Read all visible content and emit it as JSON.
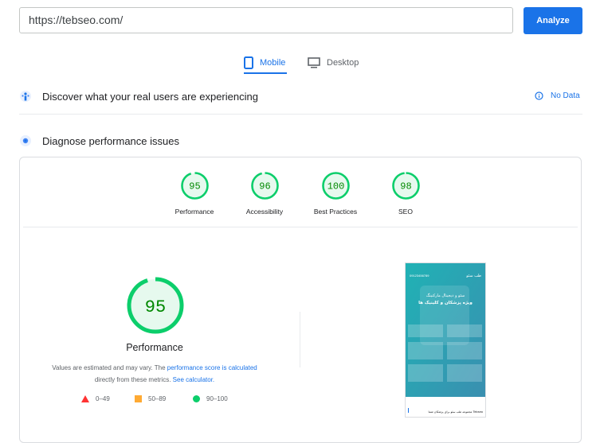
{
  "url_input": {
    "value": "https://tebseo.com/"
  },
  "analyze_button": {
    "label": "Analyze"
  },
  "tabs": [
    {
      "label": "Mobile",
      "active": true,
      "icon": "smartphone-icon"
    },
    {
      "label": "Desktop",
      "active": false,
      "icon": "monitor-icon"
    }
  ],
  "field_data": {
    "title": "Discover what your real users are experiencing",
    "no_data_label": "No Data",
    "icon": "users-icon"
  },
  "diagnose": {
    "title": "Diagnose performance issues",
    "icon": "lighthouse-icon"
  },
  "scores": [
    {
      "label": "Performance",
      "value": "95",
      "fraction": 0.95
    },
    {
      "label": "Accessibility",
      "value": "96",
      "fraction": 0.96
    },
    {
      "label": "Best Practices",
      "value": "100",
      "fraction": 1.0
    },
    {
      "label": "SEO",
      "value": "98",
      "fraction": 0.98
    }
  ],
  "main_score": {
    "value": "95",
    "fraction": 0.95,
    "label": "Performance",
    "disclaimer_1": "Values are estimated and may vary. The",
    "disclaimer_link_1": "performance score is calculated",
    "disclaimer_2": "directly from these metrics.",
    "disclaimer_link_2": "See calculator."
  },
  "legend": [
    {
      "range": "0–49",
      "color": "#ff3333",
      "shape": "triangle"
    },
    {
      "range": "50–89",
      "color": "#ffaa33",
      "shape": "square"
    },
    {
      "range": "90–100",
      "color": "#0cce6b",
      "shape": "circle"
    }
  ],
  "colors": {
    "accent": "#1a73e8",
    "pass_green": "#0cce6b",
    "pass_text": "#008800",
    "pass_fill": "#e6f9ee"
  },
  "phone_preview": {
    "header_phone": "09123456789",
    "header_logo": "طب سئو",
    "headline_1": "سئو و دیجیتال مارکتینگ",
    "headline_2": "ویژه پزشکان و کلینیک ها",
    "footer_text": "مجموعه طب سئو برای پزشکان شما Tebseo"
  }
}
